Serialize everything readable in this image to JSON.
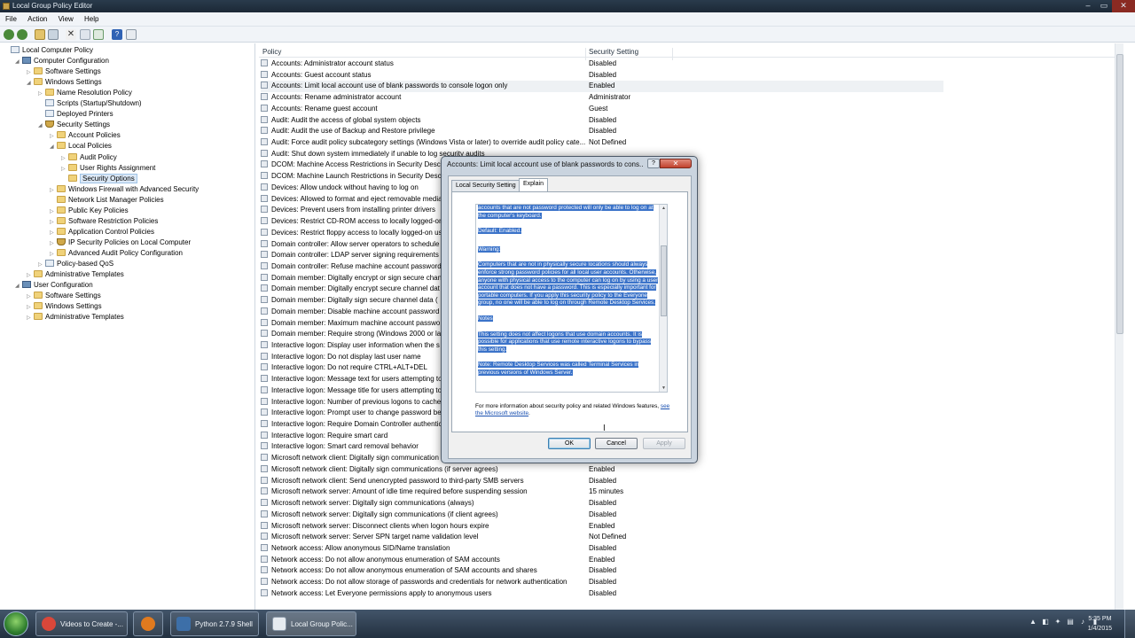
{
  "window": {
    "title": "Local Group Policy Editor",
    "controls": [
      "‒",
      "▭",
      "✕"
    ]
  },
  "menu": [
    "File",
    "Action",
    "View",
    "Help"
  ],
  "tree": [
    {
      "label": "Local Computer Policy",
      "icon": "doc-icon",
      "expander": ""
    },
    {
      "label": "Computer Configuration",
      "icon": "computer-icon",
      "expander": "◢"
    },
    {
      "label": "Software Settings",
      "icon": "folder-icon",
      "expander": "▷"
    },
    {
      "label": "Windows Settings",
      "icon": "folder-icon",
      "expander": "◢"
    },
    {
      "label": "Name Resolution Policy",
      "icon": "folder-icon",
      "expander": "▷"
    },
    {
      "label": "Scripts (Startup/Shutdown)",
      "icon": "doc-icon",
      "expander": ""
    },
    {
      "label": "Deployed Printers",
      "icon": "doc-icon",
      "expander": ""
    },
    {
      "label": "Security Settings",
      "icon": "shield-icon",
      "expander": "◢"
    },
    {
      "label": "Account Policies",
      "icon": "folder-icon",
      "expander": "▷"
    },
    {
      "label": "Local Policies",
      "icon": "folder-icon",
      "expander": "◢"
    },
    {
      "label": "Audit Policy",
      "icon": "folder-icon",
      "expander": "▷"
    },
    {
      "label": "User Rights Assignment",
      "icon": "folder-icon",
      "expander": "▷"
    },
    {
      "label": "Security Options",
      "icon": "folder-icon",
      "expander": ""
    },
    {
      "label": "Windows Firewall with Advanced Security",
      "icon": "folder-icon",
      "expander": "▷"
    },
    {
      "label": "Network List Manager Policies",
      "icon": "folder-icon",
      "expander": ""
    },
    {
      "label": "Public Key Policies",
      "icon": "folder-icon",
      "expander": "▷"
    },
    {
      "label": "Software Restriction Policies",
      "icon": "folder-icon",
      "expander": "▷"
    },
    {
      "label": "Application Control Policies",
      "icon": "folder-icon",
      "expander": "▷"
    },
    {
      "label": "IP Security Policies on Local Computer",
      "icon": "shield-icon",
      "expander": "▷"
    },
    {
      "label": "Advanced Audit Policy Configuration",
      "icon": "folder-icon",
      "expander": "▷"
    },
    {
      "label": "Policy-based QoS",
      "icon": "doc-icon",
      "expander": "▷"
    },
    {
      "label": "Administrative Templates",
      "icon": "folder-icon",
      "expander": "▷"
    },
    {
      "label": "User Configuration",
      "icon": "computer-icon",
      "expander": "◢"
    },
    {
      "label": "Software Settings",
      "icon": "folder-icon",
      "expander": "▷"
    },
    {
      "label": "Windows Settings",
      "icon": "folder-icon",
      "expander": "▷"
    },
    {
      "label": "Administrative Templates",
      "icon": "folder-icon",
      "expander": "▷"
    }
  ],
  "list": {
    "headers": {
      "policy": "Policy",
      "setting": "Security Setting"
    },
    "rows": [
      {
        "policy": "Accounts: Administrator account status",
        "setting": "Disabled"
      },
      {
        "policy": "Accounts: Guest account status",
        "setting": "Disabled"
      },
      {
        "policy": "Accounts: Limit local account use of blank passwords to console logon only",
        "setting": "Enabled"
      },
      {
        "policy": "Accounts: Rename administrator account",
        "setting": "Administrator"
      },
      {
        "policy": "Accounts: Rename guest account",
        "setting": "Guest"
      },
      {
        "policy": "Audit: Audit the access of global system objects",
        "setting": "Disabled"
      },
      {
        "policy": "Audit: Audit the use of Backup and Restore privilege",
        "setting": "Disabled"
      },
      {
        "policy": "Audit: Force audit policy subcategory settings (Windows Vista or later) to override audit policy cate...",
        "setting": "Not Defined"
      },
      {
        "policy": "Audit: Shut down system immediately if unable to log security audits",
        "setting": ""
      },
      {
        "policy": "DCOM: Machine Access Restrictions in Security Descr",
        "setting": ""
      },
      {
        "policy": "DCOM: Machine Launch Restrictions in Security Descr",
        "setting": ""
      },
      {
        "policy": "Devices: Allow undock without having to log on",
        "setting": ""
      },
      {
        "policy": "Devices: Allowed to format and eject removable media",
        "setting": ""
      },
      {
        "policy": "Devices: Prevent users from installing printer drivers",
        "setting": ""
      },
      {
        "policy": "Devices: Restrict CD-ROM access to locally logged-on",
        "setting": ""
      },
      {
        "policy": "Devices: Restrict floppy access to locally logged-on us",
        "setting": ""
      },
      {
        "policy": "Domain controller: Allow server operators to schedule",
        "setting": ""
      },
      {
        "policy": "Domain controller: LDAP server signing requirements",
        "setting": ""
      },
      {
        "policy": "Domain controller: Refuse machine account password",
        "setting": ""
      },
      {
        "policy": "Domain member: Digitally encrypt or sign secure chan",
        "setting": ""
      },
      {
        "policy": "Domain member: Digitally encrypt secure channel dat",
        "setting": ""
      },
      {
        "policy": "Domain member: Digitally sign secure channel data (",
        "setting": ""
      },
      {
        "policy": "Domain member: Disable machine account password",
        "setting": ""
      },
      {
        "policy": "Domain member: Maximum machine account passwo",
        "setting": ""
      },
      {
        "policy": "Domain member: Require strong (Windows 2000 or lat",
        "setting": ""
      },
      {
        "policy": "Interactive logon: Display user information when the s",
        "setting": ""
      },
      {
        "policy": "Interactive logon: Do not display last user name",
        "setting": ""
      },
      {
        "policy": "Interactive logon: Do not require CTRL+ALT+DEL",
        "setting": ""
      },
      {
        "policy": "Interactive logon: Message text for users attempting to",
        "setting": ""
      },
      {
        "policy": "Interactive logon: Message title for users attempting to",
        "setting": ""
      },
      {
        "policy": "Interactive logon: Number of previous logons to cache",
        "setting": ""
      },
      {
        "policy": "Interactive logon: Prompt user to change password be",
        "setting": ""
      },
      {
        "policy": "Interactive logon: Require Domain Controller authentic",
        "setting": ""
      },
      {
        "policy": "Interactive logon: Require smart card",
        "setting": ""
      },
      {
        "policy": "Interactive logon: Smart card removal behavior",
        "setting": ""
      },
      {
        "policy": "Microsoft network client: Digitally sign communication",
        "setting": ""
      },
      {
        "policy": "Microsoft network client: Digitally sign communications (if server agrees)",
        "setting": "Enabled"
      },
      {
        "policy": "Microsoft network client: Send unencrypted password to third-party SMB servers",
        "setting": "Disabled"
      },
      {
        "policy": "Microsoft network server: Amount of idle time required before suspending session",
        "setting": "15 minutes"
      },
      {
        "policy": "Microsoft network server: Digitally sign communications (always)",
        "setting": "Disabled"
      },
      {
        "policy": "Microsoft network server: Digitally sign communications (if client agrees)",
        "setting": "Disabled"
      },
      {
        "policy": "Microsoft network server: Disconnect clients when logon hours expire",
        "setting": "Enabled"
      },
      {
        "policy": "Microsoft network server: Server SPN target name validation level",
        "setting": "Not Defined"
      },
      {
        "policy": "Network access: Allow anonymous SID/Name translation",
        "setting": "Disabled"
      },
      {
        "policy": "Network access: Do not allow anonymous enumeration of SAM accounts",
        "setting": "Enabled"
      },
      {
        "policy": "Network access: Do not allow anonymous enumeration of SAM accounts and shares",
        "setting": "Disabled"
      },
      {
        "policy": "Network access: Do not allow storage of passwords and credentials for network authentication",
        "setting": "Disabled"
      },
      {
        "policy": "Network access: Let Everyone permissions apply to anonymous users",
        "setting": "Disabled"
      }
    ]
  },
  "dialog": {
    "title": "Accounts: Limit local account use of blank passwords to cons...",
    "help": "?",
    "close": "✕",
    "tabs": [
      "Local Security Setting",
      "Explain"
    ],
    "explain_paragraphs": [
      "accounts that are not password protected will only be able to log on at the computer's keyboard.",
      "Default: Enabled.",
      "Warning:",
      "Computers that are not in physically secure locations should always enforce strong password policies for all local user accounts. Otherwise, anyone with physical access to the computer can log on by using a user account that does not have a password. This is especially important for portable computers. If you apply this security policy to the Everyone group, no one will be able to log on through Remote Desktop Services.",
      "Notes",
      "This setting does not affect logons that use domain accounts. It is possible for applications that use remote interactive logons to bypass this setting.",
      "Note: Remote Desktop Services was called Terminal Services in previous versions of Windows Server."
    ],
    "more_info_text": "For more information about security policy and related Windows features,",
    "more_info_link": "see the Microsoft website",
    "more_info_end": ".",
    "buttons": {
      "ok": "OK",
      "cancel": "Cancel",
      "apply": "Apply"
    }
  },
  "taskbar": {
    "tasks": [
      {
        "label": "Videos to Create -...",
        "color": "#d9473a"
      },
      {
        "label": "",
        "color": "#e07a1f"
      },
      {
        "label": "Python 2.7.9 Shell",
        "color": "#3d6fa8"
      },
      {
        "label": "Local Group Polic...",
        "color": "#e6ebf0"
      }
    ],
    "tray_icons": [
      "▲",
      "◧",
      "✦",
      "▤",
      "♪",
      "▮"
    ],
    "clock_time": "5:35 PM",
    "clock_date": "1/4/2015"
  }
}
